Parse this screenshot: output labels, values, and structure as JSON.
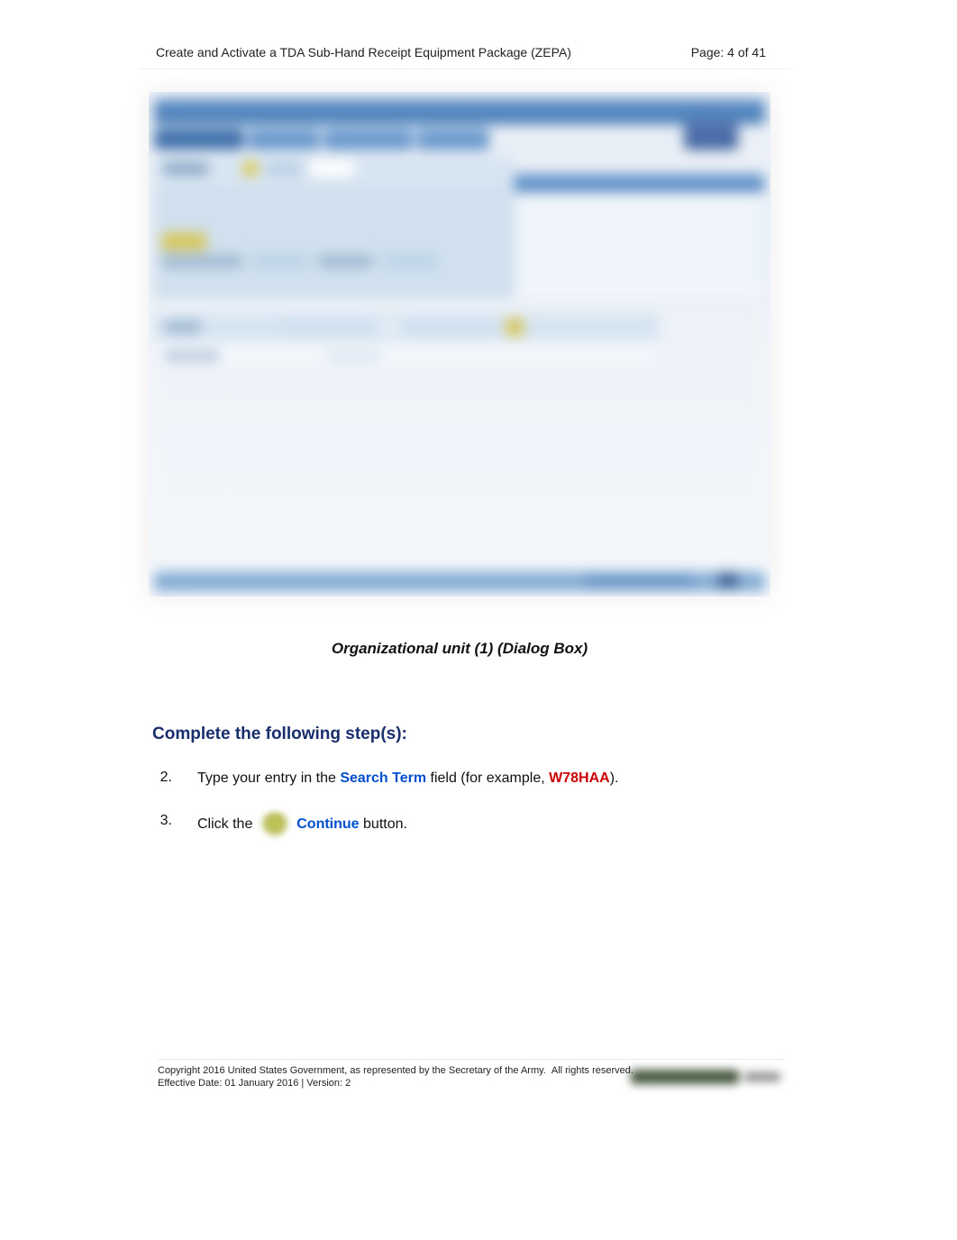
{
  "header": {
    "title": "Create and Activate a TDA Sub-Hand Receipt Equipment Package (ZEPA)",
    "page_label": "Page: 4 of 41"
  },
  "caption": "Organizational unit (1) (Dialog Box)",
  "steps_heading": "Complete the following step(s):",
  "steps": {
    "s2": {
      "num": "2.",
      "pre": "Type your entry in the ",
      "field": "Search Term",
      "mid": " field (for example, ",
      "example": "W78HAA",
      "post": ")."
    },
    "s3": {
      "num": "3.",
      "pre": "Click the ",
      "button": "Continue",
      "post": " button."
    }
  },
  "footer": {
    "copyright": "Copyright 2016 United States Government, as represented by the Secretary of the Army.",
    "rights": "All rights reserved.",
    "effective": "Effective Date:  01 January 2016 | Version: 2"
  }
}
